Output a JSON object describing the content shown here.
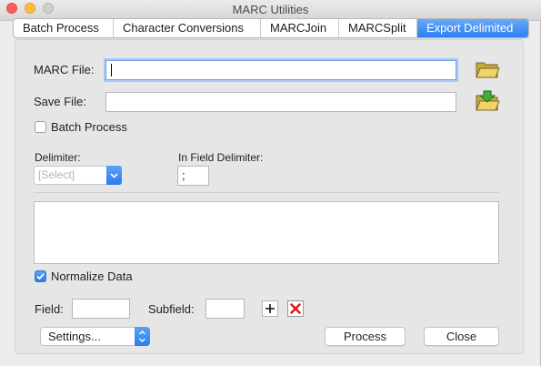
{
  "window": {
    "title": "MARC Utilities"
  },
  "tabs": [
    {
      "label": "Batch Process"
    },
    {
      "label": "Character Conversions"
    },
    {
      "label": "MARCJoin"
    },
    {
      "label": "MARCSplit"
    },
    {
      "label": "Export Delimited",
      "active": true
    }
  ],
  "form": {
    "marc_file_label": "MARC File:",
    "marc_file_value": "",
    "save_file_label": "Save File:",
    "save_file_value": "",
    "batch_process_label": "Batch Process",
    "batch_process_checked": false,
    "delimiter_label": "Delimiter:",
    "delimiter_value": "[Select]",
    "in_field_delimiter_label": "In Field Delimiter:",
    "in_field_delimiter_value": ";",
    "normalize_label": "Normalize Data",
    "normalize_checked": true,
    "field_label": "Field:",
    "field_value": "",
    "subfield_label": "Subfield:",
    "subfield_value": ""
  },
  "buttons": {
    "settings": "Settings...",
    "process": "Process",
    "close": "Close"
  },
  "icons": {
    "open_folder": "folder-open-icon",
    "save_folder": "folder-save-icon",
    "add": "plus-icon",
    "remove": "red-x-icon"
  },
  "colors": {
    "accent": "#2d7ef1",
    "remove_red": "#d8201c",
    "close_red": "#fc605c",
    "minimize_yellow": "#fdbc40"
  }
}
